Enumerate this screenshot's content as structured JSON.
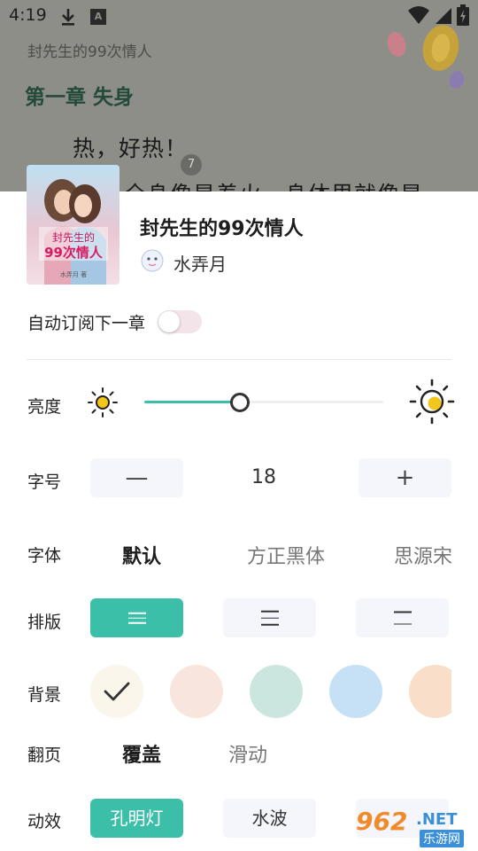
{
  "status_bar": {
    "time": "4:19",
    "icons": [
      "download-icon",
      "a-icon",
      "wifi-icon",
      "signal-icon",
      "battery-icon"
    ],
    "a_icon_glyph": "A"
  },
  "reader": {
    "book_header": "封先生的99次情人",
    "chapter_title": "第一章 失身",
    "paragraph_1": "热，好热！",
    "paragraph_2": "全身像是着火，身体里就像是",
    "page_badge": "7"
  },
  "book_info": {
    "title": "封先生的99次情人",
    "author": "水弄月",
    "cover_text_1": "封先生的",
    "cover_text_2": "99次情人",
    "cover_author": "水弄月 著"
  },
  "auto_subscribe": {
    "label": "自动订阅下一章",
    "enabled": false
  },
  "brightness": {
    "label": "亮度",
    "level": 0.4
  },
  "font_size": {
    "label": "字号",
    "minus": "—",
    "value": "18",
    "plus": "+"
  },
  "font_family": {
    "label": "字体",
    "options": [
      "默认",
      "方正黑体",
      "思源宋"
    ],
    "selected": "默认"
  },
  "layout": {
    "label": "排版",
    "options": [
      "spacing-compact",
      "spacing-normal",
      "spacing-loose"
    ],
    "selected": "spacing-compact"
  },
  "background": {
    "label": "背景",
    "colors": [
      "#fbf6ec",
      "#f8e5dd",
      "#cbe6de",
      "#c6e1f5",
      "#f9dfc9"
    ],
    "selected": 0
  },
  "page_turn": {
    "label": "翻页",
    "options": [
      "覆盖",
      "滑动"
    ],
    "selected": "覆盖"
  },
  "animation": {
    "label": "动效",
    "options": [
      "孔明灯",
      "水波",
      ""
    ],
    "selected": "孔明灯"
  },
  "watermark": {
    "number": "962",
    "suffix": ".NET",
    "site": "乐游网"
  },
  "colors": {
    "accent": "#3bbfa9",
    "chapter_title": "#244a39",
    "overlay": "#8e8e89"
  }
}
